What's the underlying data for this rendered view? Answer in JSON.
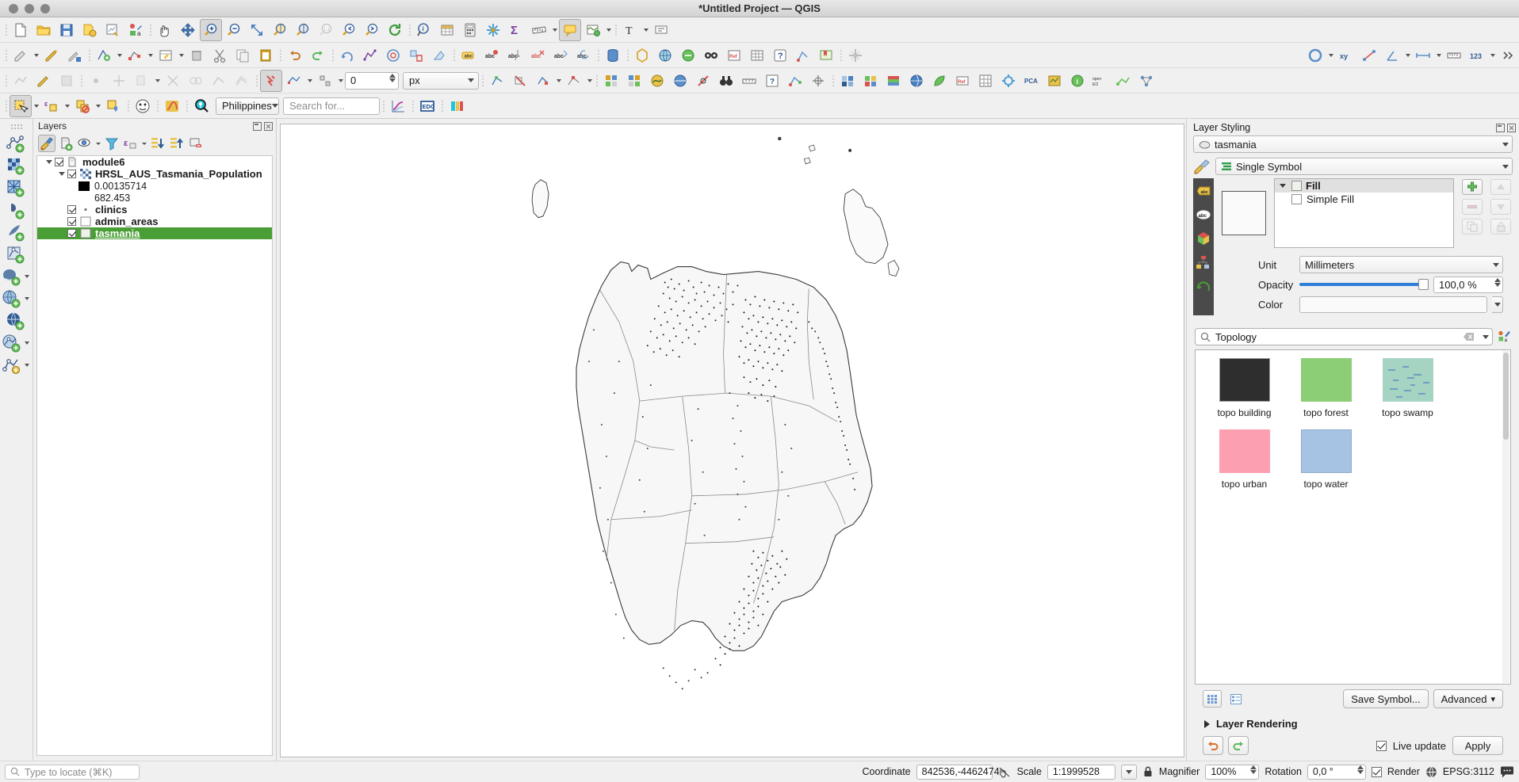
{
  "window": {
    "title": "*Untitled Project — QGIS"
  },
  "toolbars": {
    "row1": [
      {
        "name": "new-project-icon",
        "label": "New Project"
      },
      {
        "name": "open-project-icon",
        "label": "Open Project"
      },
      {
        "name": "save-project-icon",
        "label": "Save Project"
      },
      {
        "name": "save-project-as-icon",
        "label": "Save Project As"
      },
      {
        "name": "new-print-layout-icon",
        "label": "New Print Layout"
      },
      {
        "name": "style-manager-icon",
        "label": "Style Manager"
      },
      {
        "name": "pan-map-icon",
        "label": "Pan Map"
      },
      {
        "name": "pan-to-selection-icon",
        "label": "Pan Map to Selection"
      },
      {
        "name": "zoom-in-icon",
        "label": "Zoom In"
      },
      {
        "name": "zoom-out-icon",
        "label": "Zoom Out"
      },
      {
        "name": "zoom-full-icon",
        "label": "Zoom Full"
      },
      {
        "name": "zoom-selection-icon",
        "label": "Zoom to Selection"
      },
      {
        "name": "zoom-layer-icon",
        "label": "Zoom to Layer"
      },
      {
        "name": "zoom-native-icon",
        "label": "Zoom to Native Resolution"
      },
      {
        "name": "zoom-last-icon",
        "label": "Zoom Last"
      },
      {
        "name": "zoom-next-icon",
        "label": "Zoom Next"
      },
      {
        "name": "refresh-icon",
        "label": "Refresh"
      },
      {
        "name": "identify-features-icon",
        "label": "Identify Features"
      },
      {
        "name": "open-attribute-table-icon",
        "label": "Open Attribute Table"
      },
      {
        "name": "field-calculator-icon",
        "label": "Field Calculator"
      },
      {
        "name": "processing-toolbox-icon",
        "label": "Processing Toolbox"
      },
      {
        "name": "statistical-summary-icon",
        "label": "Statistical Summary"
      },
      {
        "name": "measure-line-icon",
        "label": "Measure Line"
      },
      {
        "name": "map-tips-icon",
        "label": "Show Map Tips"
      },
      {
        "name": "new-map-view-icon",
        "label": "New Map View"
      },
      {
        "name": "annotations-icon",
        "label": "Annotations"
      },
      {
        "name": "text-annotation-icon",
        "label": "Text Annotation"
      }
    ],
    "row2": [
      {
        "name": "current-edits-icon",
        "label": "Current Edits"
      },
      {
        "name": "toggle-editing-icon",
        "label": "Toggle Editing"
      },
      {
        "name": "save-layer-edits-icon",
        "label": "Save Layer Edits"
      },
      {
        "name": "add-feature-icon",
        "label": "Add Feature"
      },
      {
        "name": "vertex-tool-icon",
        "label": "Vertex Tool"
      },
      {
        "name": "modify-attributes-icon",
        "label": "Modify Attributes of Features"
      },
      {
        "name": "delete-selected-icon",
        "label": "Delete Selected"
      },
      {
        "name": "cut-features-icon",
        "label": "Cut Features"
      },
      {
        "name": "copy-features-icon",
        "label": "Copy Features"
      },
      {
        "name": "paste-features-icon",
        "label": "Paste Features"
      },
      {
        "name": "undo-icon",
        "label": "Undo"
      },
      {
        "name": "redo-icon",
        "label": "Redo"
      },
      {
        "name": "label-icon",
        "label": "Layer Labeling Options"
      },
      {
        "name": "highlight-pinned-labels-icon",
        "label": "Highlight Pinned Labels"
      },
      {
        "name": "pin-labels-icon",
        "label": "Pin/Unpin Labels"
      },
      {
        "name": "show-hide-labels-icon",
        "label": "Show/Hide Labels"
      },
      {
        "name": "move-label-icon",
        "label": "Move Label"
      },
      {
        "name": "rotate-label-icon",
        "label": "Rotate Label"
      },
      {
        "name": "change-label-icon",
        "label": "Change Label"
      },
      {
        "name": "db-manager-icon",
        "label": "DB Manager"
      },
      {
        "name": "processing-hex-icon",
        "label": "Processing"
      },
      {
        "name": "georeferencer-icon",
        "label": "Georeferencer"
      },
      {
        "name": "metasearch-icon",
        "label": "MetaSearch"
      },
      {
        "name": "plugins-icon",
        "label": "Plugins"
      },
      {
        "name": "qgis2web-icon",
        "label": "qgis2web"
      },
      {
        "name": "help-icon",
        "label": "Help"
      },
      {
        "name": "topology-checker-icon",
        "label": "Topology Checker"
      },
      {
        "name": "spatial-bookmark-icon",
        "label": "Spatial Bookmarks"
      },
      {
        "name": "cad-construction-icon",
        "label": "Enable Advanced Digitizing"
      }
    ],
    "row3_value": "0",
    "row3_unit": "px",
    "row3": [
      {
        "name": "snapping-toggle-icon",
        "label": "Toggle Snapping"
      },
      {
        "name": "snapping-mode-icon",
        "label": "Snapping Mode"
      },
      {
        "name": "snapping-type-icon",
        "label": "Snapping Type"
      },
      {
        "name": "topological-editing-icon",
        "label": "Topological Editing"
      },
      {
        "name": "avoid-overlap-icon",
        "label": "Avoid Overlap"
      },
      {
        "name": "self-snapping-icon",
        "label": "Self-snapping"
      },
      {
        "name": "raster-calculator-icon",
        "label": "Raster Calculator"
      },
      {
        "name": "mesh-calculator-icon",
        "label": "Mesh Calculator"
      },
      {
        "name": "interpolation-icon",
        "label": "Interpolation"
      },
      {
        "name": "georeferencer2-icon",
        "label": "Georeferencer"
      },
      {
        "name": "gps-icon",
        "label": "GPS Information"
      },
      {
        "name": "plugin-manager-icon",
        "label": "Plugin Manager"
      },
      {
        "name": "grass-icon",
        "label": "GRASS"
      },
      {
        "name": "pca-icon",
        "label": "PCA"
      },
      {
        "name": "semi-automatic-classification-icon",
        "label": "SCP"
      },
      {
        "name": "info-icon",
        "label": "Info"
      },
      {
        "name": "openeo-icon",
        "label": "openEO"
      },
      {
        "name": "qneat-icon",
        "label": "QNEAT3"
      }
    ],
    "row4": {
      "region": "Philippines",
      "search_placeholder": "Search for...",
      "buttons": [
        {
          "name": "select-features-icon",
          "label": "Select Features by Area"
        },
        {
          "name": "select-by-expression-icon",
          "label": "Select by Expression"
        },
        {
          "name": "deselect-features-icon",
          "label": "Deselect Features"
        },
        {
          "name": "select-value-icon",
          "label": "Select by Value"
        },
        {
          "name": "mask-icon",
          "label": "Mask"
        },
        {
          "name": "profile-tool-icon",
          "label": "Profile Tool"
        },
        {
          "name": "geocoder-search-icon",
          "label": "Geocoder"
        },
        {
          "name": "plot-icon",
          "label": "Data Plotly"
        },
        {
          "name": "edc-icon",
          "label": "EDC"
        },
        {
          "name": "swiss-locator-icon",
          "label": "Swiss Locator"
        }
      ]
    }
  },
  "left_toolbar": [
    {
      "name": "new-shapefile-layer-icon",
      "label": "New Shapefile Layer"
    },
    {
      "name": "new-geopackage-layer-icon",
      "label": "New GeoPackage Layer"
    },
    {
      "name": "new-spatialite-layer-icon",
      "label": "New SpatiaLite Layer"
    },
    {
      "name": "new-temporary-scratch-layer-icon",
      "label": "New Temporary Scratch Layer"
    },
    {
      "name": "new-virtual-layer-icon",
      "label": "New Virtual Layer"
    },
    {
      "name": "add-vector-layer-icon",
      "label": "Add Vector Layer"
    },
    {
      "name": "add-postgis-layer-icon",
      "label": "Add PostGIS Layer"
    },
    {
      "name": "add-wms-layer-icon",
      "label": "Add WMS/WMTS Layer"
    },
    {
      "name": "add-wfs-layer-icon",
      "label": "Add WFS Layer"
    },
    {
      "name": "add-xyz-layer-icon",
      "label": "Add XYZ Layer"
    },
    {
      "name": "add-delimited-text-layer-icon",
      "label": "Add Delimited Text Layer"
    }
  ],
  "layers_panel": {
    "title": "Layers",
    "toolbar": [
      {
        "name": "open-layer-styling-panel-button",
        "label": "Open the Layer Styling panel",
        "selected": true
      },
      {
        "name": "add-group-button",
        "label": "Add Group"
      },
      {
        "name": "manage-map-themes-button",
        "label": "Manage Map Themes"
      },
      {
        "name": "filter-legend-button",
        "label": "Filter Legend"
      },
      {
        "name": "filter-legend-expression-button",
        "label": "Filter Legend by Expression"
      },
      {
        "name": "expand-all-button",
        "label": "Expand All"
      },
      {
        "name": "collapse-all-button",
        "label": "Collapse All"
      },
      {
        "name": "remove-layer-button",
        "label": "Remove Layer/Group"
      }
    ],
    "tree": [
      {
        "name": "module6",
        "type": "group",
        "icon": "group-icon",
        "checked": true,
        "expanded": true,
        "indent": 0,
        "selected": false
      },
      {
        "name": "HRSL_AUS_Tasmania_Population",
        "type": "raster",
        "icon": "raster-icon",
        "checked": true,
        "expanded": true,
        "indent": 1,
        "selected": false
      },
      {
        "name": "0.00135714",
        "type": "legend",
        "swatch": "#000000",
        "indent": 2
      },
      {
        "name": "682.453",
        "type": "legend",
        "swatch": "transparent",
        "indent": 2
      },
      {
        "name": "clinics",
        "type": "point",
        "icon": "point-icon",
        "checked": true,
        "indent": 1,
        "selected": false
      },
      {
        "name": "admin_areas",
        "type": "polygon",
        "icon": "polygon-icon",
        "swatch": "#ffffff",
        "checked": true,
        "indent": 1,
        "selected": false
      },
      {
        "name": "tasmania",
        "type": "polygon",
        "icon": "polygon-icon",
        "swatch": "#eef3ea",
        "checked": true,
        "indent": 1,
        "selected": true
      }
    ]
  },
  "style_panel": {
    "title": "Layer Styling",
    "layer": "tasmania",
    "renderer": "Single Symbol",
    "symbol_layers": {
      "root_label": "Fill",
      "child_label": "Simple Fill"
    },
    "side_buttons": [
      {
        "name": "add-symbol-layer-button",
        "label": "Add symbol layer"
      },
      {
        "name": "move-symbol-layer-up-button",
        "label": "Move up"
      },
      {
        "name": "remove-symbol-layer-button",
        "label": "Remove symbol layer"
      },
      {
        "name": "move-symbol-layer-down-button",
        "label": "Move down"
      },
      {
        "name": "duplicate-symbol-layer-button",
        "label": "Duplicate"
      },
      {
        "name": "lock-colors-button",
        "label": "Lock colors"
      }
    ],
    "properties": {
      "unit_label": "Unit",
      "unit_value": "Millimeters",
      "opacity_label": "Opacity",
      "opacity_value": "100,0 %",
      "color_label": "Color"
    },
    "browser": {
      "search_value": "Topology",
      "symbols": [
        {
          "label": "topo building",
          "color": "#2e2e2e"
        },
        {
          "label": "topo forest",
          "color": "#8bce75"
        },
        {
          "label": "topo swamp",
          "color": "#a6d4c2"
        },
        {
          "label": "topo urban",
          "color": "#fb9fb1"
        },
        {
          "label": "topo water",
          "color": "#a7c3e3"
        }
      ]
    },
    "footer": {
      "save_symbol_label": "Save Symbol...",
      "advanced_label": "Advanced",
      "layer_rendering_label": "Layer Rendering",
      "live_update_label": "Live update",
      "live_update_checked": true,
      "apply_label": "Apply"
    }
  },
  "statusbar": {
    "locator_placeholder": "Type to locate (⌘K)",
    "coordinate_label": "Coordinate",
    "coordinate_value": "842536,-4462474",
    "scale_label": "Scale",
    "scale_value": "1:1999528",
    "magnifier_label": "Magnifier",
    "magnifier_value": "100%",
    "rotation_label": "Rotation",
    "rotation_value": "0,0 °",
    "render_label": "Render",
    "render_checked": true,
    "crs_label": "EPSG:3112",
    "messages_label": "Messages"
  },
  "colors": {
    "selection_green": "#4a9e36",
    "accent_blue": "#2f7fd8",
    "panel_bg": "#f0f0f0"
  }
}
